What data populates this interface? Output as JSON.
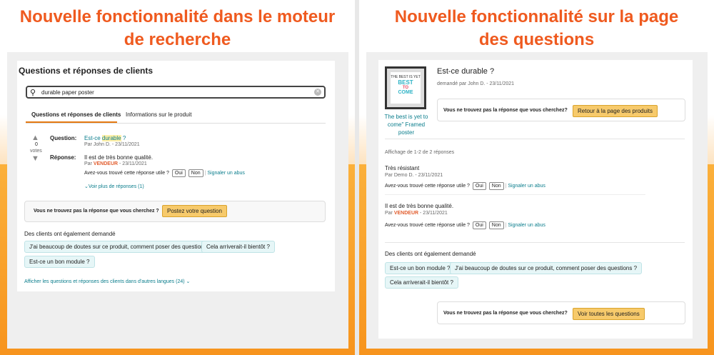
{
  "left": {
    "heading_line1": "Nouvelle fonctionnalité dans le moteur",
    "heading_line2": "de recherche",
    "title": "Questions et réponses de clients",
    "search_value": "durable paper poster",
    "tabs": [
      "Questions et réponses de clients",
      "Informations sur le produit"
    ],
    "votes_count": "0",
    "votes_label": "votes",
    "question_label": "Question:",
    "question_pre": "Est-ce ",
    "question_hl": "durable",
    "question_post": " ?",
    "question_by": "Par John D. - 23/11/2021",
    "answer_label": "Réponse:",
    "answer_text": "Il est de très bonne qualité.",
    "answer_by_pre": "Par ",
    "answer_vendor": "VENDEUR",
    "answer_by_post": " - 23/11/2021",
    "helpful_q": "Avez-vous trouvé cette réponse utile ?",
    "yes": "Oui",
    "no": "Non",
    "report": "Signaler un abus",
    "more": "Voir plus de réponses (1)",
    "notfound_text": "Vous ne trouvez pas la réponse que vous cherchez ?",
    "notfound_btn": "Postez votre question",
    "also_asked": "Des clients ont également demandé",
    "chips": [
      "J'ai beaucoup de doutes sur ce produit, comment poser des questions ?",
      "Cela arriverait-il bientôt ?",
      "Est-ce un bon module ?"
    ],
    "other_langs": "Afficher les questions et réponses des clients dans d'autres langues (24)"
  },
  "right": {
    "heading_line1": "Nouvelle fonctionnalité sur la page",
    "heading_line2": "des questions",
    "product_name": "The best is yet to come\" Framed poster",
    "poster_lines": [
      "THE BEST IS YET",
      "BEST",
      "TO",
      "COME"
    ],
    "question": "Est-ce durable ?",
    "question_by": "demandé par John D. - 23/11/2021",
    "notfound_text": "Vous ne trouvez pas la réponse que vous cherchez?",
    "notfound_btn": "Retour à la page des produits",
    "showing": "Affichage de 1-2 de 2 réponses",
    "answers": [
      {
        "text": "Très résistant",
        "by_pre": "Par Demo D. - 23/11/2021",
        "vendor": ""
      },
      {
        "text": "Il est de très bonne qualité.",
        "by_pre": "Par ",
        "vendor": "VENDEUR",
        "by_post": " - 23/11/2021"
      }
    ],
    "helpful_q": "Avez-vous trouvé cette réponse utile ?",
    "yes": "Oui",
    "no": "Non",
    "report": "Signaler un abus",
    "also_asked": "Des clients ont également demandé",
    "chips": [
      "Est-ce un bon module ?",
      "J'ai beaucoup de doutes sur ce produit, comment poser des questions ?",
      "Cela arriverait-il bientôt ?"
    ],
    "notfound2_text": "Vous ne trouvez pas la réponse que vous cherchez?",
    "notfound2_btn": "Voir toutes les questions"
  },
  "colors": {
    "heading": "#ef5a1f",
    "orange": "#f7941d",
    "link": "#0a7d8c",
    "button": "#f7ca6b"
  }
}
